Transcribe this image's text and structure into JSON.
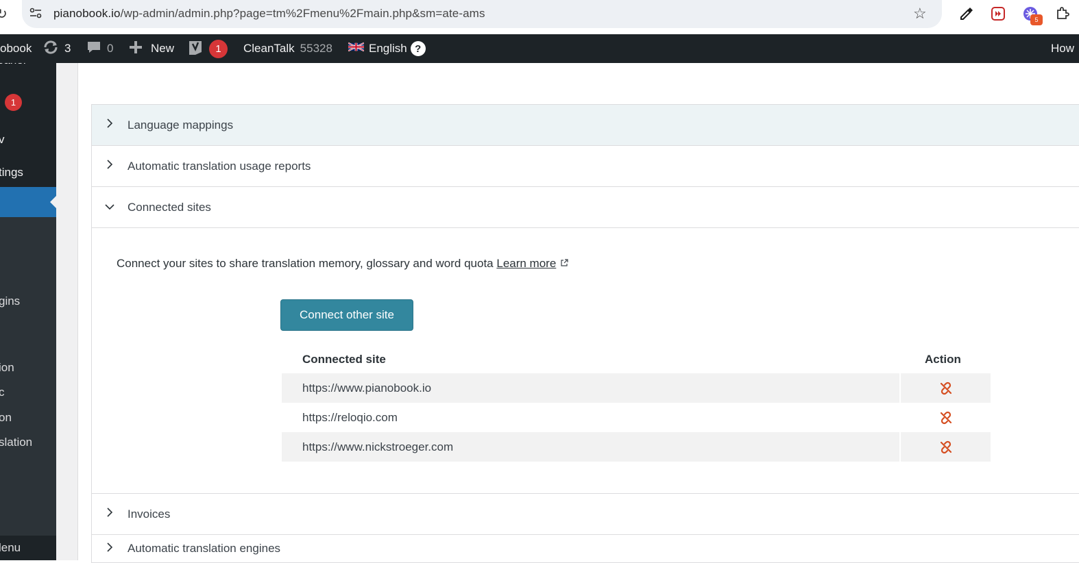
{
  "browser": {
    "url_host": "pianobook.io",
    "url_path": "/wp-admin/admin.php?page=tm%2Fmenu%2Fmain.php&sm=ate-ams",
    "extension_badge": "5"
  },
  "adminbar": {
    "site_name": "obook",
    "updates_count": "3",
    "comments_count": "0",
    "new_label": "New",
    "yoast_count": "1",
    "cleantalk_label": "CleanTalk",
    "cleantalk_count": "55328",
    "language": "English",
    "help": "?",
    "howdy": "How"
  },
  "adminmenu": {
    "top_fragment": "eaner",
    "badge": "1",
    "fragment_v": "v",
    "settings_fragment": "tings",
    "sub_items": [
      "gins",
      "ion",
      "c",
      "on",
      "slation"
    ],
    "bottom_fragment": "lenu"
  },
  "accordion": {
    "sections": [
      {
        "label": "Language mappings",
        "expanded": false
      },
      {
        "label": "Automatic translation usage reports",
        "expanded": false
      },
      {
        "label": "Connected sites",
        "expanded": true
      },
      {
        "label": "Invoices",
        "expanded": false
      },
      {
        "label": "Automatic translation engines",
        "expanded": false
      }
    ]
  },
  "connected_sites": {
    "description": "Connect your sites to share translation memory, glossary and word quota",
    "learn_more": "Learn more",
    "connect_button": "Connect other site",
    "col_site": "Connected site",
    "col_action": "Action",
    "rows": [
      {
        "site": "https://www.pianobook.io"
      },
      {
        "site": "https://reloqio.com"
      },
      {
        "site": "https://www.nickstroeger.com"
      }
    ]
  },
  "colors": {
    "adminbar": "#1d2327",
    "menu_active": "#2271b1",
    "button": "#33879e",
    "unlink_icon": "#d54e21"
  }
}
